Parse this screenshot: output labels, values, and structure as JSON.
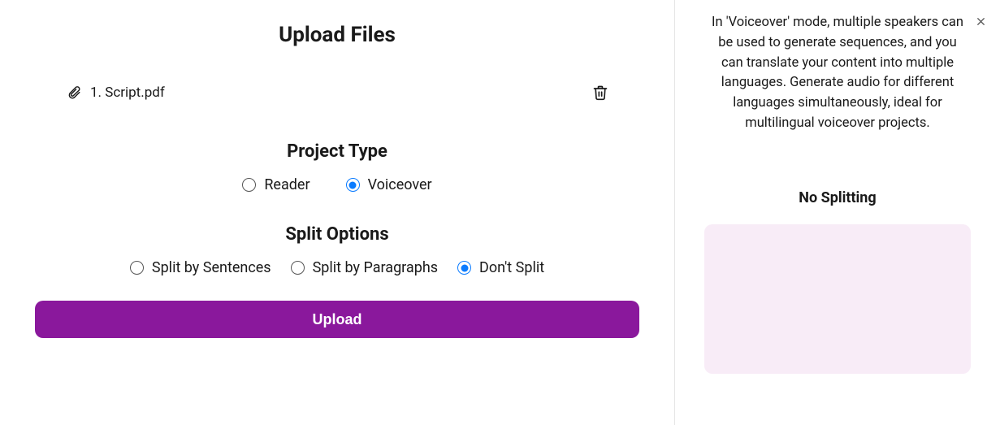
{
  "page_title": "Upload Files",
  "file": {
    "index_label": "1. Script.pdf"
  },
  "project_type": {
    "heading": "Project Type",
    "options": {
      "reader": "Reader",
      "voiceover": "Voiceover"
    },
    "selected": "voiceover"
  },
  "split_options": {
    "heading": "Split Options",
    "options": {
      "sentences": "Split by Sentences",
      "paragraphs": "Split by Paragraphs",
      "none": "Don't Split"
    },
    "selected": "none"
  },
  "upload_button": "Upload",
  "side": {
    "description": "In 'Voiceover' mode, multiple speakers can be used to generate sequences, and you can translate your content into multiple languages. Generate audio for different languages simultaneously, ideal for multilingual voiceover projects.",
    "heading": "No Splitting"
  }
}
